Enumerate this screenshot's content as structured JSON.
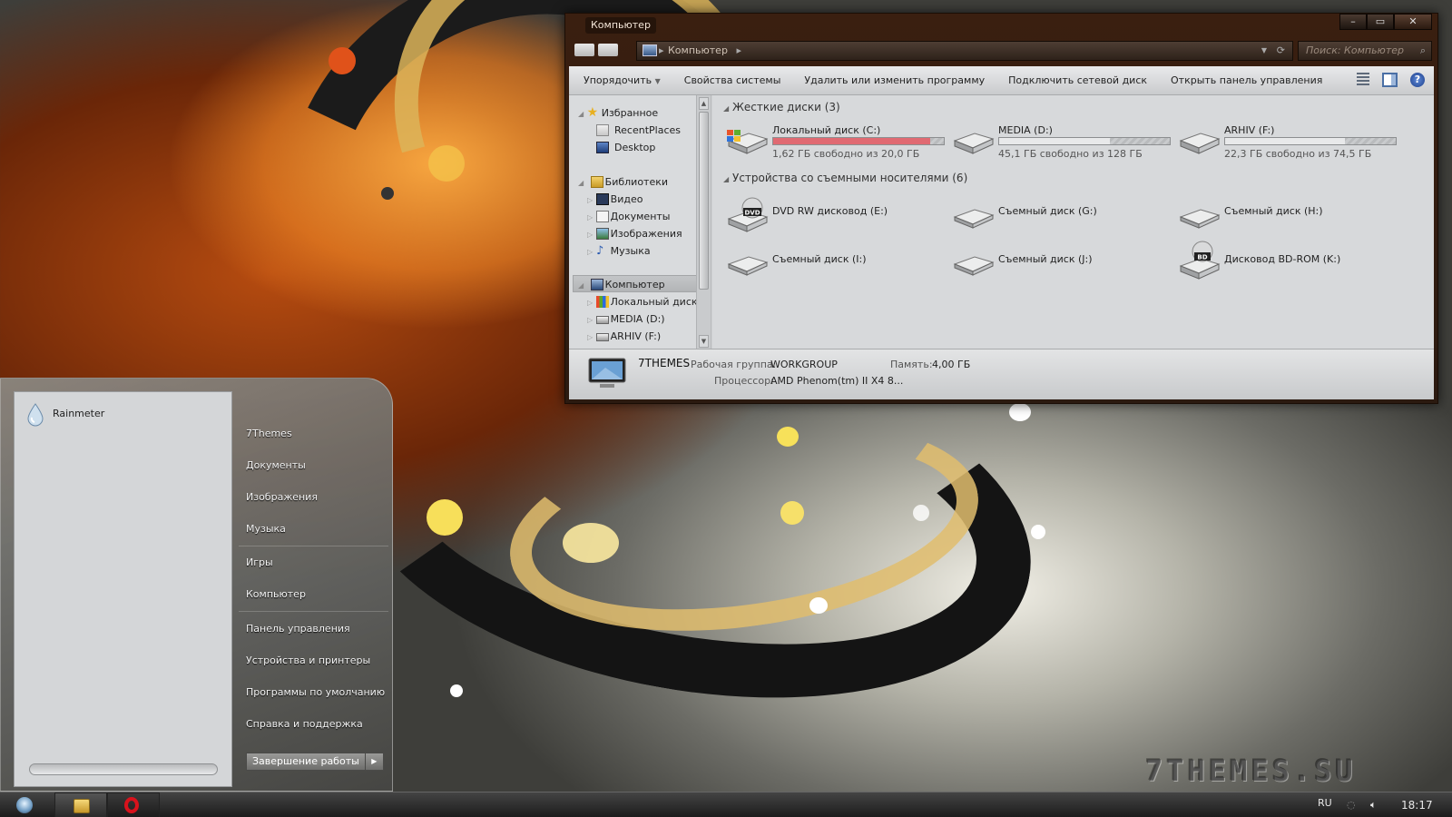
{
  "explorer": {
    "title": "Компьютер",
    "address": "Компьютер",
    "search_placeholder": "Поиск: Компьютер",
    "toolbar": [
      "Упорядочить",
      "Свойства системы",
      "Удалить или изменить программу",
      "Подключить сетевой диск",
      "Открыть панель управления"
    ],
    "nav": {
      "favorites": "Избранное",
      "recent": "RecentPlaces",
      "desktop": "Desktop",
      "libraries": "Библиотеки",
      "video": "Видео",
      "docs": "Документы",
      "images": "Изображения",
      "music": "Музыка",
      "computer": "Компьютер",
      "disk_c": "Локальный диск (",
      "media_d": "MEDIA (D:)",
      "arhiv_f": "ARHIV (F:)"
    },
    "groups": {
      "hdd": "Жесткие диски (3)",
      "removable": "Устройства со съемными носителями (6)"
    },
    "hdd": [
      {
        "name": "Локальный диск (C:)",
        "free": "1,62 ГБ свободно из 20,0 ГБ",
        "used_fraction": 0.92,
        "color": "#e06a72"
      },
      {
        "name": "MEDIA (D:)",
        "free": "45,1 ГБ свободно из 128 ГБ",
        "used_fraction": 0.65,
        "color": "#e8e9ea"
      },
      {
        "name": "ARHIV (F:)",
        "free": "22,3 ГБ свободно из 74,5 ГБ",
        "used_fraction": 0.7,
        "color": "#e8e9ea"
      }
    ],
    "removable": [
      {
        "name": "DVD RW дисковод (E:)",
        "badge": "DVD"
      },
      {
        "name": "Съемный диск (G:)"
      },
      {
        "name": "Съемный диск (H:)"
      },
      {
        "name": "Съемный диск (I:)"
      },
      {
        "name": "Съемный диск (J:)"
      },
      {
        "name": "Дисковод BD-ROM (K:)",
        "badge": "BD"
      }
    ],
    "details": {
      "pc_name": "7THEMES",
      "workgroup_label": "Рабочая группа:",
      "workgroup": "WORKGROUP",
      "memory_label": "Память:",
      "memory": "4,00 ГБ",
      "cpu_label": "Процессор:",
      "cpu": "AMD Phenom(tm) II X4 8..."
    }
  },
  "startmenu": {
    "pinned": "Rainmeter",
    "items": [
      "7Themes",
      "Документы",
      "Изображения",
      "Музыка",
      "Игры",
      "Компьютер",
      "Панель управления",
      "Устройства и принтеры",
      "Программы по умолчанию",
      "Справка и поддержка"
    ],
    "shutdown": "Завершение работы"
  },
  "watermark": "7THEMES.SU",
  "tray": {
    "lang": "RU",
    "time": "18:17"
  }
}
